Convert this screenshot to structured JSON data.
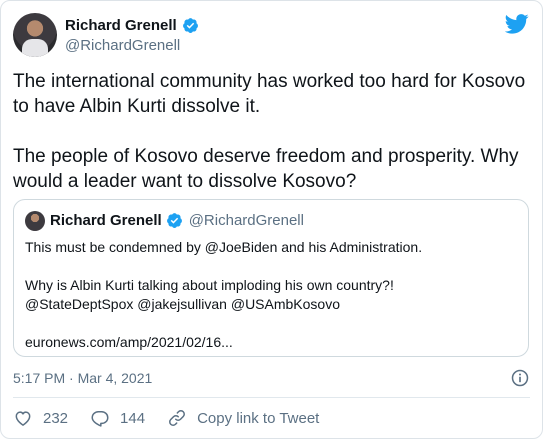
{
  "colors": {
    "brand": "#1da1f2",
    "secondary_text": "#5b7083",
    "primary_text": "#0f1419"
  },
  "author": {
    "name": "Richard Grenell",
    "handle": "@RichardGrenell"
  },
  "tweet": {
    "paragraphs": [
      "The international community has worked too hard for Kosovo to have Albin Kurti dissolve it.",
      "The people of Kosovo deserve freedom and prosperity. Why would a leader want to dissolve Kosovo?"
    ]
  },
  "quoted": {
    "name": "Richard Grenell",
    "handle": "@RichardGrenell",
    "lines": [
      "This must be condemned by @JoeBiden and his Administration.",
      "",
      "Why is Albin Kurti talking about imploding his own country?!",
      "@StateDeptSpox @jakejsullivan @USAmbKosovo",
      "",
      "euronews.com/amp/2021/02/16..."
    ]
  },
  "meta": {
    "timestamp": "5:17 PM · Mar 4, 2021"
  },
  "actions": {
    "likes": "232",
    "replies": "144",
    "copy_link_label": "Copy link to Tweet"
  },
  "icons": [
    "twitter-bird-icon",
    "verified-badge-icon",
    "info-icon",
    "heart-icon",
    "reply-icon",
    "link-icon"
  ]
}
